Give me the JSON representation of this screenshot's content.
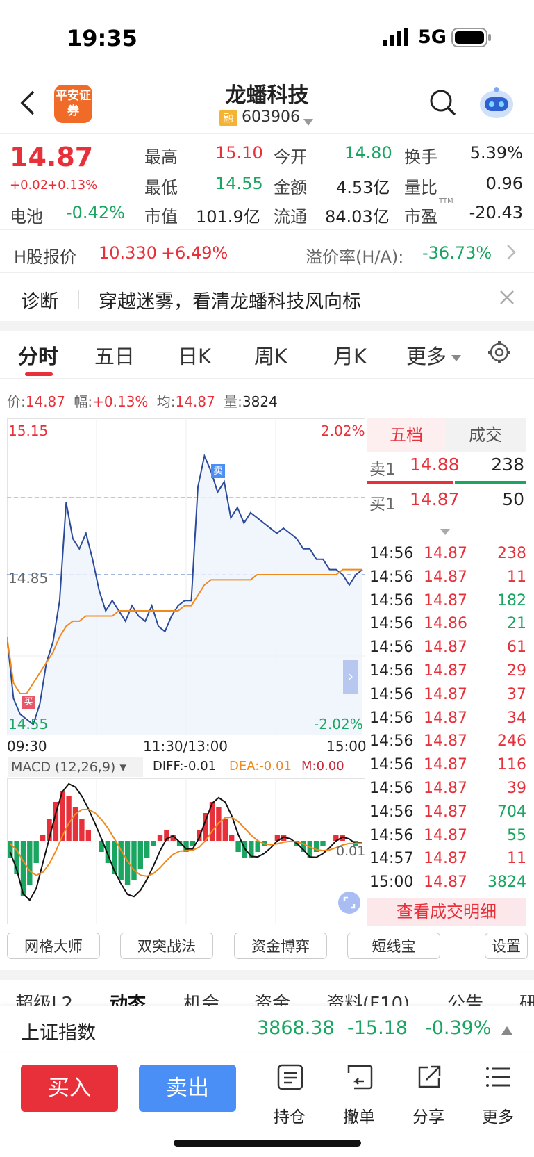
{
  "status_bar": {
    "time": "19:35",
    "network": "5G"
  },
  "header": {
    "title": "龙蟠科技",
    "broker_logo": "平安证券",
    "margin_badge": "融",
    "code": "603906",
    "icons": [
      "back-arrow-icon",
      "search-icon",
      "robot-assistant-icon"
    ]
  },
  "quote": {
    "price": "14.87",
    "change": "+0.02",
    "change_pct": "+0.13%",
    "sector_label": "电池",
    "sector_change": "-0.42%",
    "fields": [
      {
        "label": "最高",
        "value": "15.10",
        "color": "red"
      },
      {
        "label": "今开",
        "value": "14.80",
        "color": "green"
      },
      {
        "label": "换手",
        "value": "5.39%",
        "color": "black"
      },
      {
        "label": "最低",
        "value": "14.55",
        "color": "green"
      },
      {
        "label": "金额",
        "value": "4.53亿",
        "color": "black"
      },
      {
        "label": "量比",
        "value": "0.96",
        "color": "black"
      },
      {
        "label": "市值",
        "value": "101.9亿",
        "color": "black"
      },
      {
        "label": "流通",
        "value": "84.03亿",
        "color": "black"
      },
      {
        "label": "市盈",
        "value": "-20.43",
        "color": "black",
        "sup": "TTM"
      }
    ]
  },
  "h_share": {
    "label": "H股报价",
    "price": "10.330",
    "change": "+6.49%",
    "premium_label": "溢价率(H/A):",
    "premium": "-36.73%"
  },
  "diagnosis": {
    "label": "诊断",
    "text": "穿越迷雾，看清龙蟠科技风向标"
  },
  "tabs": [
    "分时",
    "五日",
    "日K",
    "周K",
    "月K",
    "更多"
  ],
  "active_tab": "分时",
  "info_line": {
    "price_label": "价:",
    "price": "14.87",
    "range_label": "幅:",
    "range": "+0.13%",
    "avg_label": "均:",
    "avg": "14.87",
    "vol_label": "量:",
    "vol": "3824"
  },
  "chart_labels": {
    "top_price": "15.15",
    "top_pct": "2.02%",
    "mid_price": "14.85",
    "bottom_price": "14.55",
    "bottom_pct": "-2.02%",
    "x_start": "09:30",
    "x_mid": "11:30/13:00",
    "x_end": "15:00",
    "sell_marker": "卖",
    "buy_marker": "买"
  },
  "macd": {
    "selector": "MACD (12,26,9)",
    "diff": "DIFF:-0.01",
    "dea": "DEA:-0.01",
    "m": "M:0.00",
    "zero_label": "0.01"
  },
  "order_book": {
    "tabs": [
      "五档",
      "成交"
    ],
    "ask1_label": "卖1",
    "ask1_price": "14.88",
    "ask1_vol": "238",
    "bid1_label": "买1",
    "bid1_price": "14.87",
    "bid1_vol": "50",
    "ticks": [
      {
        "t": "14:56",
        "p": "14.87",
        "v": "238",
        "c": "red"
      },
      {
        "t": "14:56",
        "p": "14.87",
        "v": "11",
        "c": "red"
      },
      {
        "t": "14:56",
        "p": "14.87",
        "v": "182",
        "c": "green"
      },
      {
        "t": "14:56",
        "p": "14.86",
        "v": "21",
        "c": "green"
      },
      {
        "t": "14:56",
        "p": "14.87",
        "v": "61",
        "c": "red"
      },
      {
        "t": "14:56",
        "p": "14.87",
        "v": "29",
        "c": "red"
      },
      {
        "t": "14:56",
        "p": "14.87",
        "v": "37",
        "c": "red"
      },
      {
        "t": "14:56",
        "p": "14.87",
        "v": "34",
        "c": "red"
      },
      {
        "t": "14:56",
        "p": "14.87",
        "v": "246",
        "c": "red"
      },
      {
        "t": "14:56",
        "p": "14.87",
        "v": "116",
        "c": "red"
      },
      {
        "t": "14:56",
        "p": "14.87",
        "v": "39",
        "c": "red"
      },
      {
        "t": "14:56",
        "p": "14.87",
        "v": "704",
        "c": "green"
      },
      {
        "t": "14:56",
        "p": "14.87",
        "v": "55",
        "c": "green"
      },
      {
        "t": "14:57",
        "p": "14.87",
        "v": "11",
        "c": "red"
      },
      {
        "t": "15:00",
        "p": "14.87",
        "v": "3824",
        "c": "green"
      }
    ],
    "detail_button": "查看成交明细"
  },
  "tools": [
    "网格大师",
    "双突战法",
    "资金博弈",
    "短线宝",
    "设置"
  ],
  "sub_tabs": [
    "超级L2",
    "动态",
    "机会",
    "资金",
    "资料(F10)",
    "公告",
    "研"
  ],
  "index_bar": {
    "name": "上证指数",
    "value": "3868.38",
    "change": "-15.18",
    "pct": "-0.39%"
  },
  "bottom_bar": {
    "buy": "买入",
    "sell": "卖出",
    "actions": [
      "持仓",
      "撤单",
      "分享",
      "更多"
    ]
  },
  "colors": {
    "up": "#e8303a",
    "down": "#1aa561",
    "price_line": "#2b4a9a",
    "avg_line": "#f08a1e",
    "sell_btn": "#4a8ff5"
  },
  "chart_data": {
    "type": "line",
    "title": "",
    "xlabel": "",
    "ylabel": "",
    "ylim": [
      14.55,
      15.15
    ],
    "x_ticks": [
      "09:30",
      "11:30/13:00",
      "15:00"
    ],
    "prev_close": 14.85,
    "series": [
      {
        "values": [
          14.73,
          14.61,
          14.58,
          14.57,
          14.56,
          14.6,
          14.68,
          14.72,
          14.8,
          14.99,
          14.92,
          14.9,
          14.93,
          14.88,
          14.82,
          14.78,
          14.8,
          14.78,
          14.76,
          14.79,
          14.77,
          14.76,
          14.79,
          14.75,
          14.74,
          14.77,
          14.79,
          14.8,
          14.8,
          15.02,
          15.08,
          15.05,
          15.01,
          15.03,
          14.96,
          14.98,
          14.95,
          14.97,
          14.96,
          14.95,
          14.94,
          14.93,
          14.94,
          14.93,
          14.92,
          14.9,
          14.9,
          14.88,
          14.88,
          14.86,
          14.86,
          14.85,
          14.83,
          14.85,
          14.86
        ]
      },
      {
        "values": [
          14.73,
          14.64,
          14.62,
          14.62,
          14.64,
          14.66,
          14.68,
          14.7,
          14.73,
          14.75,
          14.76,
          14.76,
          14.77,
          14.77,
          14.77,
          14.77,
          14.77,
          14.78,
          14.78,
          14.78,
          14.78,
          14.78,
          14.78,
          14.78,
          14.78,
          14.78,
          14.78,
          14.79,
          14.79,
          14.81,
          14.83,
          14.84,
          14.84,
          14.84,
          14.84,
          14.84,
          14.84,
          14.84,
          14.85,
          14.85,
          14.85,
          14.85,
          14.85,
          14.85,
          14.85,
          14.85,
          14.85,
          14.85,
          14.85,
          14.85,
          14.85,
          14.86,
          14.86,
          14.86,
          14.86
        ]
      }
    ],
    "macd_hist": [
      -3,
      -6,
      -10,
      -8,
      -4,
      1,
      4,
      7,
      9,
      8,
      6,
      4,
      2,
      0,
      -2,
      -4,
      -6,
      -7,
      -8,
      -7,
      -5,
      -3,
      -1,
      1,
      2,
      1,
      -1,
      -2,
      -1,
      2,
      5,
      7,
      6,
      4,
      1,
      -2,
      -3,
      -3,
      -2,
      -1,
      0,
      1,
      1,
      0,
      -1,
      -2,
      -3,
      -2,
      -1,
      0,
      1,
      1,
      0,
      -1,
      0
    ]
  }
}
